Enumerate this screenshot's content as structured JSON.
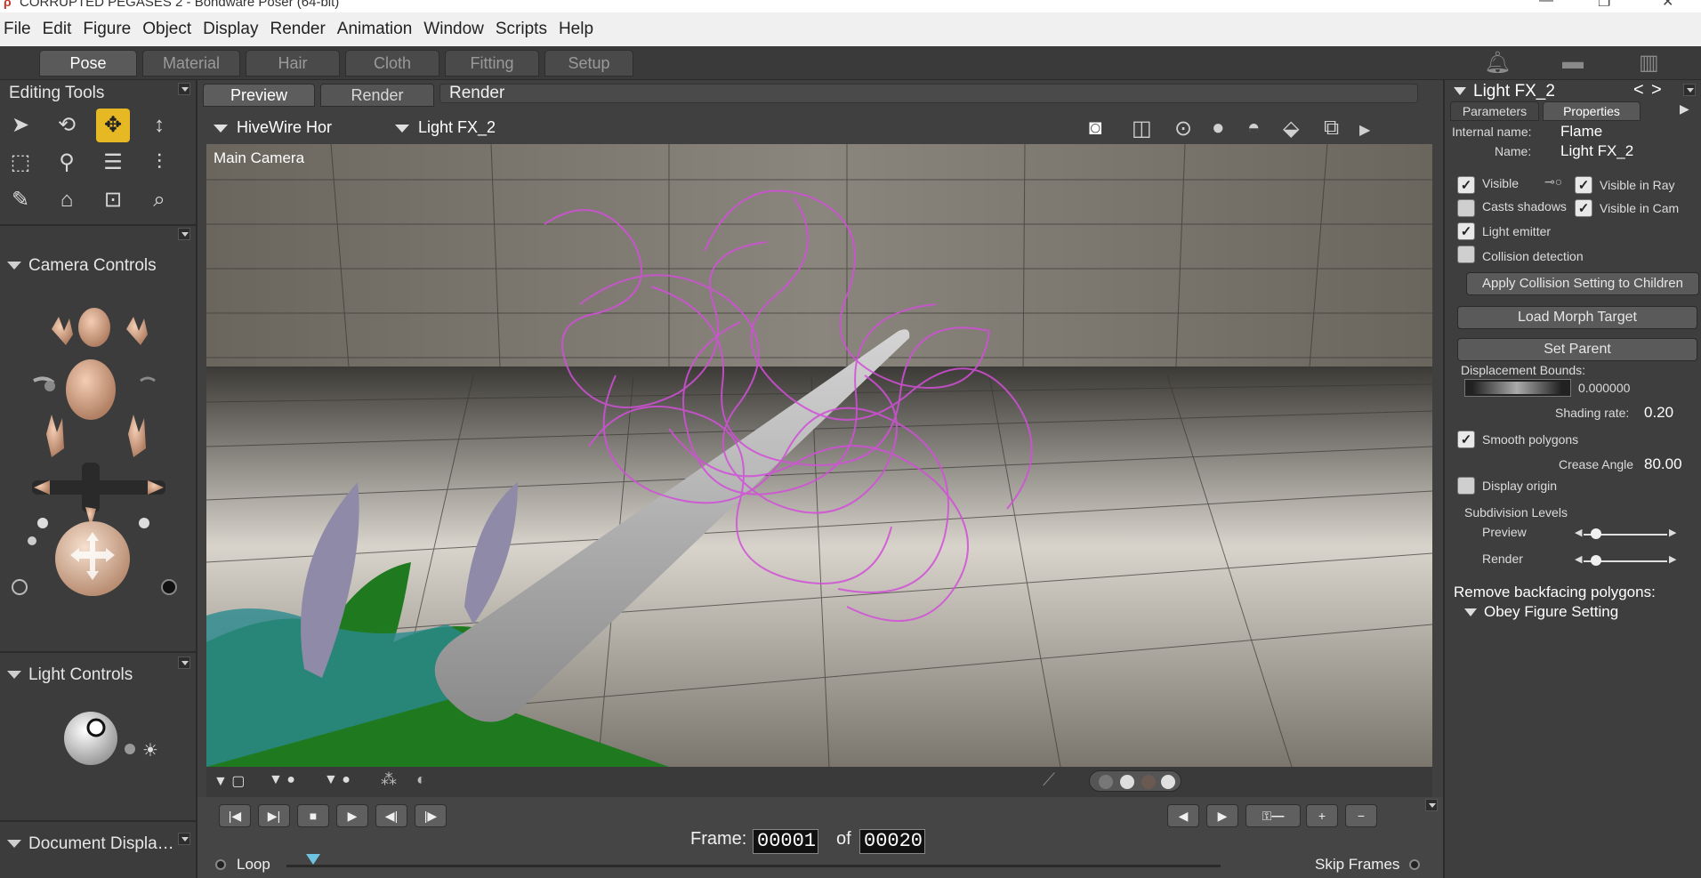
{
  "window": {
    "title": "CORRUPTED PEGASES 2 - Bondware Poser (64-bit)"
  },
  "menu": [
    "File",
    "Edit",
    "Figure",
    "Object",
    "Display",
    "Render",
    "Animation",
    "Window",
    "Scripts",
    "Help"
  ],
  "rooms": [
    "Pose",
    "Material",
    "Hair",
    "Cloth",
    "Fitting",
    "Setup"
  ],
  "left": {
    "editing_tools_title": "Editing Tools",
    "camera_controls_title": "Camera Controls",
    "light_controls_title": "Light Controls",
    "document_display_title": "Document Displa…"
  },
  "doc_tabs": {
    "preview": "Preview",
    "render": "Render",
    "render_title": "Render"
  },
  "viewport": {
    "figure_dropdown": "HiveWire Hor",
    "actor_dropdown": "Light FX_2",
    "camera_label": "Main Camera"
  },
  "transport": {
    "frame_label": "Frame:",
    "current_frame": "00001",
    "of_label": "of",
    "total_frames": "00020",
    "loop_label": "Loop",
    "skip_frames_label": "Skip Frames"
  },
  "props": {
    "header_title": "Light FX_2",
    "tab_parameters": "Parameters",
    "tab_properties": "Properties",
    "internal_name_label": "Internal name:",
    "internal_name_value": "Flame",
    "name_label": "Name:",
    "name_value": "Light FX_2",
    "visible": "Visible",
    "visible_in_ray": "Visible in Ray",
    "casts_shadows": "Casts shadows",
    "visible_in_cam": "Visible in Cam",
    "light_emitter": "Light emitter",
    "collision_detection": "Collision detection",
    "apply_collision": "Apply Collision Setting to Children",
    "load_morph_target": "Load Morph Target",
    "set_parent": "Set Parent",
    "displacement_bounds_label": "Displacement Bounds:",
    "displacement_bounds_value": "0.000000",
    "shading_rate_label": "Shading rate:",
    "shading_rate_value": "0.20",
    "smooth_polygons": "Smooth polygons",
    "crease_angle_label": "Crease Angle",
    "crease_angle_value": "80.00",
    "display_origin": "Display origin",
    "subdivision_levels": "Subdivision Levels",
    "subdiv_preview": "Preview",
    "subdiv_render": "Render",
    "remove_backfacing": "Remove backfacing polygons:",
    "obey_figure_setting": "Obey Figure Setting"
  },
  "checks": {
    "visible": true,
    "visible_in_ray": true,
    "casts_shadows": false,
    "visible_in_cam": true,
    "light_emitter": true,
    "collision_detection": false,
    "smooth_polygons": true,
    "display_origin": false
  },
  "colors": {
    "active_tool": "#e6b824",
    "flame_fx": "#d24fd8",
    "figure_green": "#1f7a1f",
    "horn_gray": "#a8a8a8"
  }
}
